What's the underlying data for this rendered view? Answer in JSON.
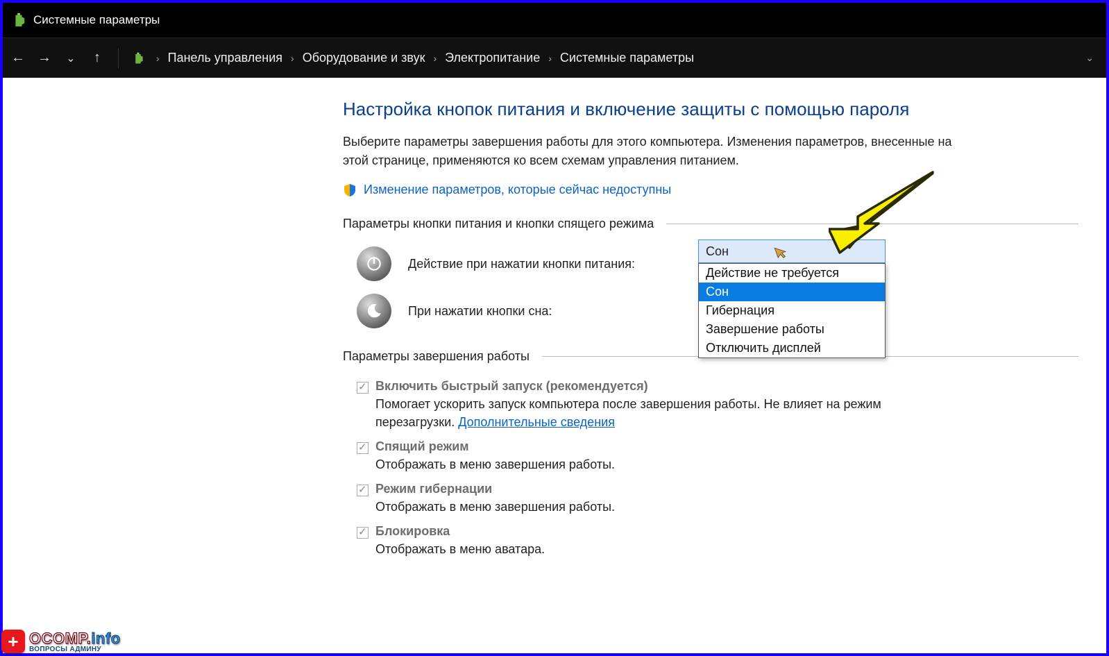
{
  "window": {
    "title": "Системные параметры"
  },
  "breadcrumb": {
    "items": [
      "Панель управления",
      "Оборудование и звук",
      "Электропитание",
      "Системные параметры"
    ]
  },
  "page": {
    "title": "Настройка кнопок питания и включение защиты с помощью пароля",
    "description": "Выберите параметры завершения работы для этого компьютера. Изменения параметров, внесенные на этой странице, применяются ко всем схемам управления питанием.",
    "change_link": "Изменение параметров, которые сейчас недоступны"
  },
  "sections": {
    "buttons_header": "Параметры кнопки питания и кнопки спящего режима",
    "power_button_label": "Действие при нажатии кнопки питания:",
    "sleep_button_label": "При нажатии кнопки сна:",
    "shutdown_header": "Параметры завершения работы"
  },
  "dropdown": {
    "selected": "Сон",
    "options": [
      "Действие не требуется",
      "Сон",
      "Гибернация",
      "Завершение работы",
      "Отключить дисплей"
    ],
    "highlighted_index": 1
  },
  "shutdown_options": {
    "fast_startup": {
      "label": "Включить быстрый запуск (рекомендуется)",
      "desc_pre": "Помогает ускорить запуск компьютера после завершения работы. Не влияет на режим перезагрузки. ",
      "link": "Дополнительные сведения"
    },
    "sleep": {
      "label": "Спящий режим",
      "desc": "Отображать в меню завершения работы."
    },
    "hibernate": {
      "label": "Режим гибернации",
      "desc": "Отображать в меню завершения работы."
    },
    "lock": {
      "label": "Блокировка",
      "desc": "Отображать в меню аватара."
    }
  },
  "watermark": {
    "badge": "+",
    "brand_a": "OCOMP",
    "brand_dot": ".",
    "brand_b": "info",
    "sub": "ВОПРОСЫ АДМИНУ"
  }
}
